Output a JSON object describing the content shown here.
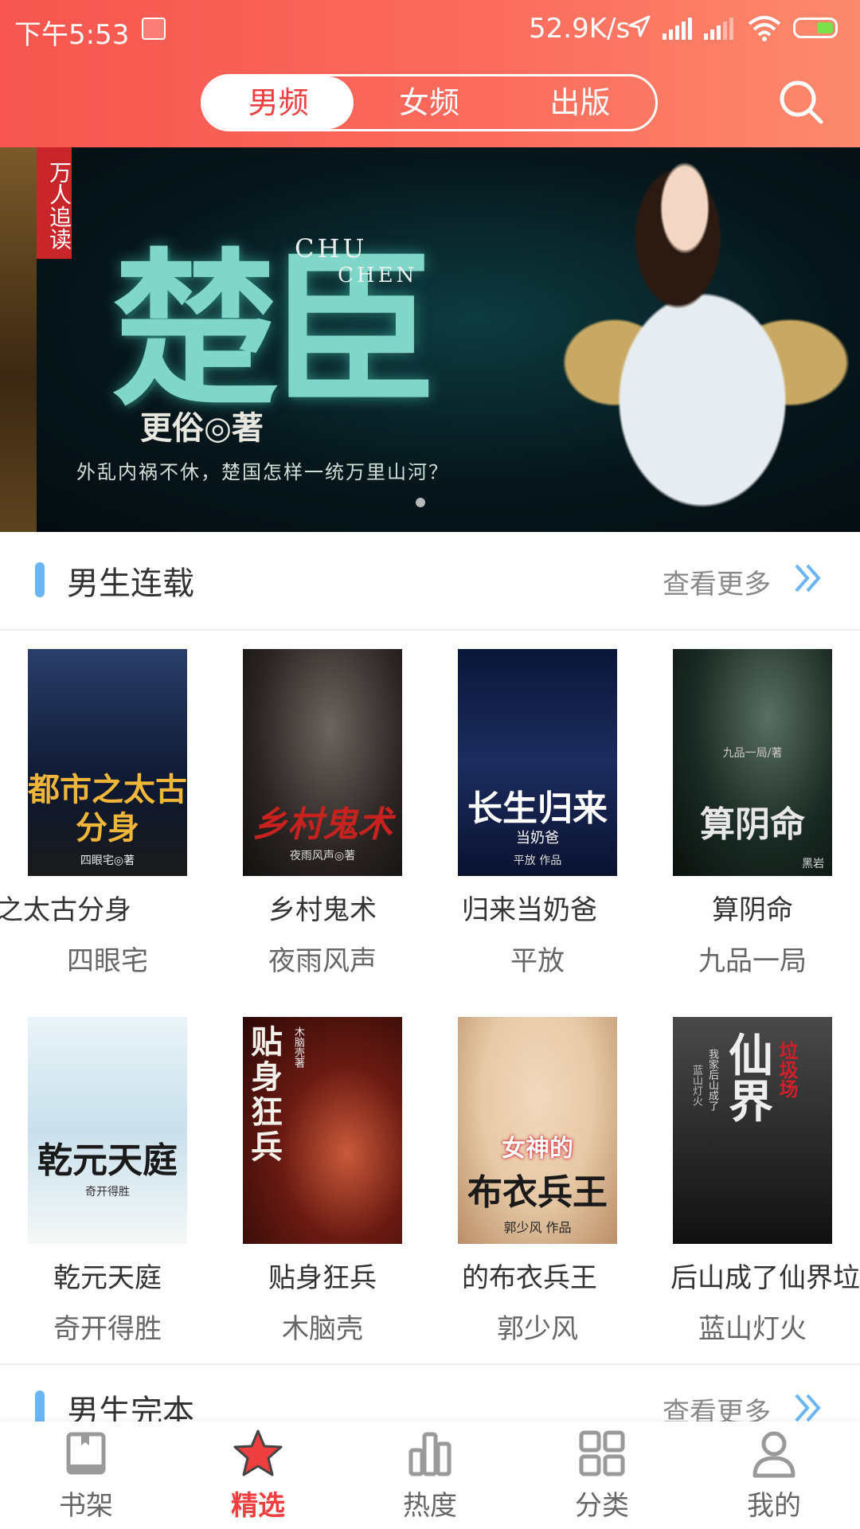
{
  "status_bar": {
    "time": "下午5:53",
    "speed": "52.9K/s",
    "icons": [
      "notification-icon",
      "location-arrow-icon",
      "signal-icon",
      "signal-icon",
      "wifi-icon",
      "battery-charging-icon"
    ]
  },
  "header": {
    "tabs": [
      {
        "label": "男频",
        "active": true
      },
      {
        "label": "女频",
        "active": false
      },
      {
        "label": "出版",
        "active": false
      }
    ],
    "search_icon": "search-icon"
  },
  "banner": {
    "ribbon": "万人追读",
    "title": "楚臣",
    "title_en_line1": "CHU",
    "title_en_line2": "CHEN",
    "author": "更俗◎著",
    "tagline": "外乱内祸不休，楚国怎样一统万里山河？",
    "page_indicator": {
      "current": 1
    }
  },
  "section_serial": {
    "title": "男生连载",
    "more": "查看更多",
    "books": [
      {
        "title": "都市之太古分身",
        "display_title": "之太古分身",
        "author": "四眼宅",
        "cover_text": "都市之太古分身",
        "cover_text2": "四眼宅◎著",
        "cover_bg": "#1b2b4a",
        "cover_fg": "#f0b63a"
      },
      {
        "title": "乡村鬼术",
        "display_title": "乡村鬼术",
        "author": "夜雨风声",
        "cover_text": "乡村鬼术",
        "cover_text2": "夜雨风声◎著",
        "cover_bg": "#2a2422",
        "cover_fg": "#c8221f"
      },
      {
        "title": "长生归来当奶爸",
        "display_title": "归来当奶爸",
        "author": "平放",
        "cover_text": "长生归来",
        "cover_text2": "当奶爸",
        "cover_text3": "平放 作品",
        "cover_bg": "#0c1a3a",
        "cover_fg": "#ffffff"
      },
      {
        "title": "算阴命",
        "display_title": "算阴命",
        "author": "九品一局",
        "cover_text": "算阴命",
        "cover_text2": "九品一局/著",
        "cover_text3": "黑岩",
        "cover_bg": "#1a2a24",
        "cover_fg": "#e8e8e8"
      },
      {
        "title": "乾元天庭",
        "display_title": "乾元天庭",
        "author": "奇开得胜",
        "cover_text": "乾元天庭",
        "cover_text2": "奇开得胜",
        "cover_bg": "#d9e9f2",
        "cover_fg": "#1a1a1a"
      },
      {
        "title": "贴身狂兵",
        "display_title": "贴身狂兵",
        "author": "木脑壳",
        "cover_text": "贴身狂兵",
        "cover_text2": "木脑壳著",
        "cover_bg": "#3a0e0b",
        "cover_fg": "#f3f0ea"
      },
      {
        "title": "女神的布衣兵王",
        "display_title": "的布衣兵王",
        "author": "郭少风",
        "cover_text": "女神的",
        "cover_text2": "布衣兵王",
        "cover_text3": "郭少风 作品",
        "cover_bg": "#e6c9a6",
        "cover_fg": "#d11f2a"
      },
      {
        "title": "我家后山成了仙界垃圾场",
        "display_title": "后山成了仙界垃",
        "author": "蓝山灯火",
        "cover_text": "仙界",
        "cover_text2": "垃圾场",
        "cover_text3": "我家后山成了",
        "cover_text4": "蓝山灯火",
        "cover_bg": "#2c2c2c",
        "cover_fg": "#e8e8e8"
      }
    ]
  },
  "section_complete": {
    "title": "男生完本",
    "more": "查看更多"
  },
  "bottom_nav": [
    {
      "label": "书架",
      "icon": "bookshelf-icon",
      "active": false
    },
    {
      "label": "精选",
      "icon": "star-icon",
      "active": true
    },
    {
      "label": "热度",
      "icon": "bar-chart-icon",
      "active": false
    },
    {
      "label": "分类",
      "icon": "grid-icon",
      "active": false
    },
    {
      "label": "我的",
      "icon": "user-icon",
      "active": false
    }
  ],
  "colors": {
    "accent": "#ee3e3f",
    "header_gradient_start": "#f6564f",
    "header_gradient_end": "#fc8a6c",
    "section_bar": "#6ab6f4",
    "chevron": "#6ab6f4",
    "inactive_icon": "#9a9a9a"
  }
}
